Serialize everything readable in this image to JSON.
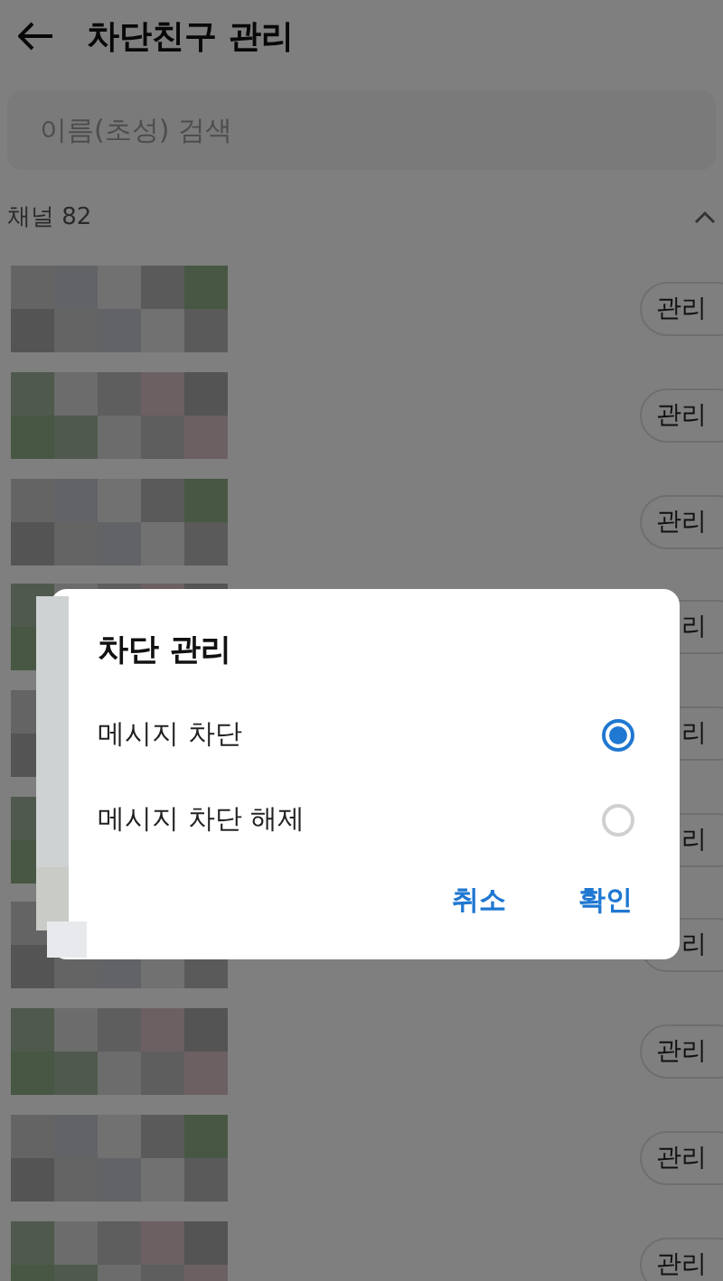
{
  "header": {
    "title": "차단친구 관리"
  },
  "search": {
    "placeholder": "이름(초성) 검색"
  },
  "section": {
    "label": "채널 82",
    "expanded": true
  },
  "rows": [
    {
      "button": "관리"
    },
    {
      "button": "관리"
    },
    {
      "button": "관리"
    },
    {
      "button": "리"
    },
    {
      "button": "리"
    },
    {
      "button": "리"
    },
    {
      "button": "리"
    },
    {
      "button": "관리"
    },
    {
      "button": "관리"
    },
    {
      "button": "관리"
    }
  ],
  "dialog": {
    "title": "차단 관리",
    "options": [
      {
        "label": "메시지 차단",
        "selected": true
      },
      {
        "label": "메시지 차단 해제",
        "selected": false
      }
    ],
    "buttons": [
      {
        "label": "취소"
      },
      {
        "label": "확인"
      }
    ]
  }
}
